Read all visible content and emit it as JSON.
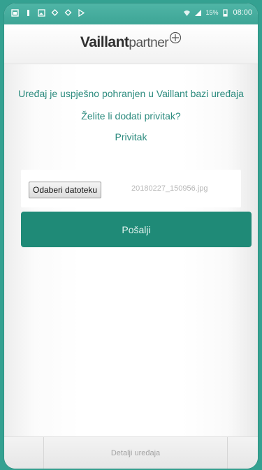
{
  "status_bar": {
    "battery_percent": "15%",
    "time": "08:00",
    "left_icons": [
      "notification-icon",
      "usb-icon",
      "image-icon",
      "location-icon",
      "location-icon",
      "play-icon"
    ],
    "right_icons": [
      "wifi-icon",
      "signal-icon",
      "battery-icon"
    ]
  },
  "header": {
    "logo_brand": "Vaillant",
    "logo_suffix": "partner"
  },
  "main": {
    "success_message": "Uređaj je uspješno pohranjen u Vaillant bazi uređaja",
    "question": "Želite li dodati privitak?",
    "attachment_label": "Privitak",
    "file_button_label": "Odaberi datoteku",
    "selected_file": "20180227_150956.jpg",
    "send_button_label": "Pošalji"
  },
  "bottom_nav": {
    "tab_label": "Detalji uređaja"
  },
  "colors": {
    "accent": "#1f8a77",
    "text_accent": "#2a8a7d",
    "background": "#34a191"
  }
}
